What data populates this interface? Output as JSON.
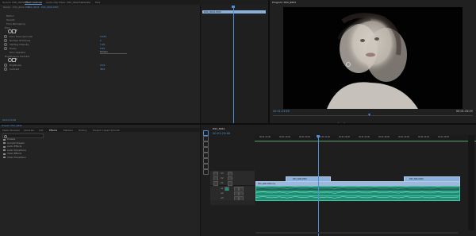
{
  "source_panel": {
    "tabs": [
      "Source: DSC_6641",
      "Effect Controls",
      "Audio Clip Mixer: DSC_6641",
      "Metadata",
      "Text"
    ],
    "active_tab": 1,
    "master": "Master · DSC_6641.MOV",
    "clip": "DSC_6641 · DSC_6641.MOV",
    "properties": [
      "Motion",
      "Opacity",
      "Time Remapping",
      "Echo",
      "Echo Time (seconds)",
      "Number Of Echoes",
      "Starting Intensity",
      "Decay",
      "Echo Operator",
      "Brightness & Contrast",
      "Brightness",
      "Contrast"
    ],
    "values": {
      "echo_time": "0.033",
      "echoes": "2",
      "intensity": "1.00",
      "decay": "0.50",
      "operator": "Screen",
      "brightness": "13.0",
      "contrast": "38.0"
    },
    "timecode": "00:01:23:48",
    "mini_clip": "DSC_6641.MOV"
  },
  "program_panel": {
    "title": "Program: DSC_6641",
    "timecode_left": "00:01:23:48",
    "timecode_right": "00:01:33:29",
    "controls": [
      "marker-icon",
      "in-point-icon",
      "out-point-icon",
      "go-to-in-icon",
      "step-back-icon",
      "play-icon",
      "step-forward-icon",
      "go-to-out-icon",
      "lift-icon",
      "extract-icon",
      "export-frame-icon"
    ]
  },
  "project_panel": {
    "label": "Project: DSC_6641",
    "tabs": [
      "Media Browser",
      "Libraries",
      "Info",
      "Effects",
      "Markers",
      "History",
      "Project: Liquid Smooth"
    ],
    "active_tab": 3,
    "folders": [
      "Presets",
      "Lumetri Presets",
      "Audio Effects",
      "Audio Transitions",
      "Video Effects",
      "Video Transitions"
    ]
  },
  "timeline_panel": {
    "sequence": "DSC_6641",
    "timecode": "00:01:23:48",
    "ruler": [
      "00:01:12:00",
      "00:01:16:00",
      "00:01:20:00",
      "00:01:24:00",
      "00:01:28:00",
      "00:01:32:00",
      "00:01:36:00",
      "00:01:40:00",
      "00:01:44:00",
      "00:01:48:00"
    ],
    "video_tracks": [
      "V3",
      "V2",
      "V1"
    ],
    "audio_tracks": [
      "A1",
      "A2",
      "A3"
    ],
    "clips": {
      "v2_a": "DSC_6641.MOV",
      "v2_b": "DSC_6641.MOV",
      "v1": "DSC_6641.MOV [V]"
    }
  },
  "colors": {
    "accent": "#4f8fd8",
    "video_clip": "#8ab0dc",
    "audio_clip": "#1f8d74"
  }
}
